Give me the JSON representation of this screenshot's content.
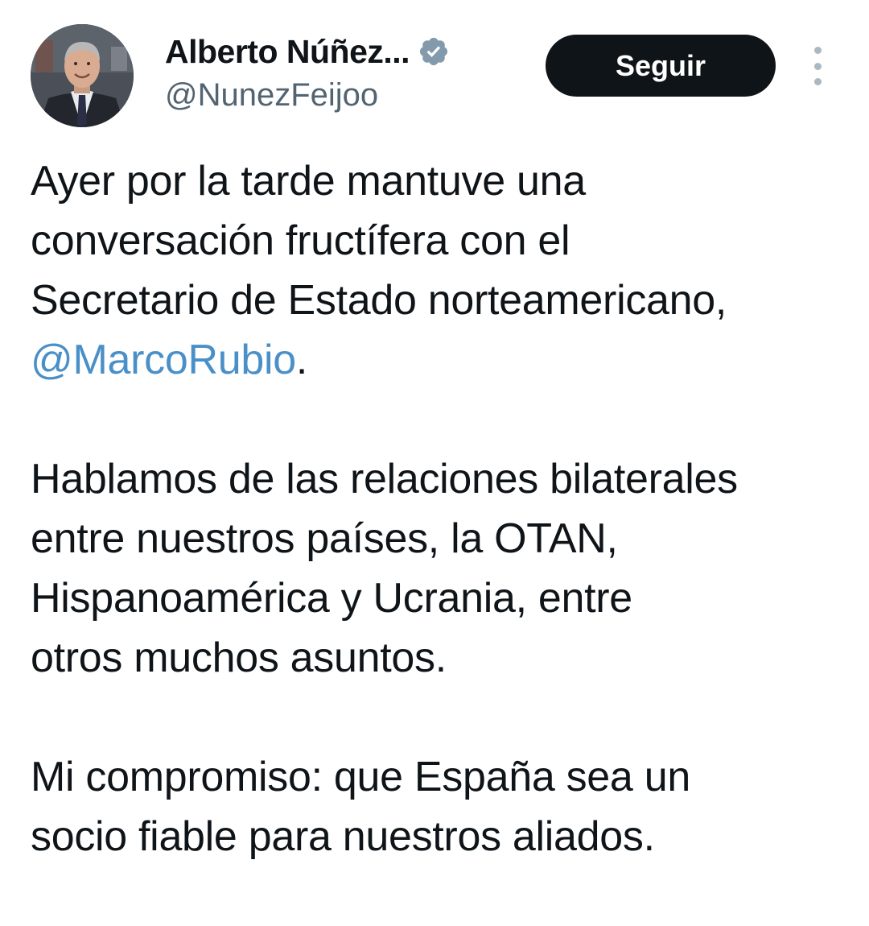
{
  "tweet": {
    "author": {
      "display_name": "Alberto Núñez...",
      "handle": "@NunezFeijoo",
      "verified_icon": "verified-badge-icon",
      "avatar_icon": "avatar-photo"
    },
    "follow_label": "Seguir",
    "more_icon": "more-vertical-icon",
    "body": {
      "p1": {
        "line1": "Ayer por la tarde mantuve una",
        "line2": "conversación fructífera con el",
        "line3": "Secretario de Estado norteamericano,",
        "mention": "@MarcoRubio",
        "after_mention": "."
      },
      "p2": {
        "line1": "Hablamos de las relaciones bilaterales",
        "line2": "entre nuestros países, la OTAN,",
        "line3": "Hispanoamérica y Ucrania, entre",
        "line4": "otros muchos asuntos."
      },
      "p3": {
        "line1": "Mi compromiso: que España sea un",
        "line2": "socio fiable para nuestros aliados."
      }
    },
    "colors": {
      "text": "#0f1419",
      "secondary": "#536471",
      "mention": "#4a90c8",
      "button_bg": "#0f1419",
      "button_text": "#ffffff",
      "verified_badge": "#829aab"
    }
  }
}
